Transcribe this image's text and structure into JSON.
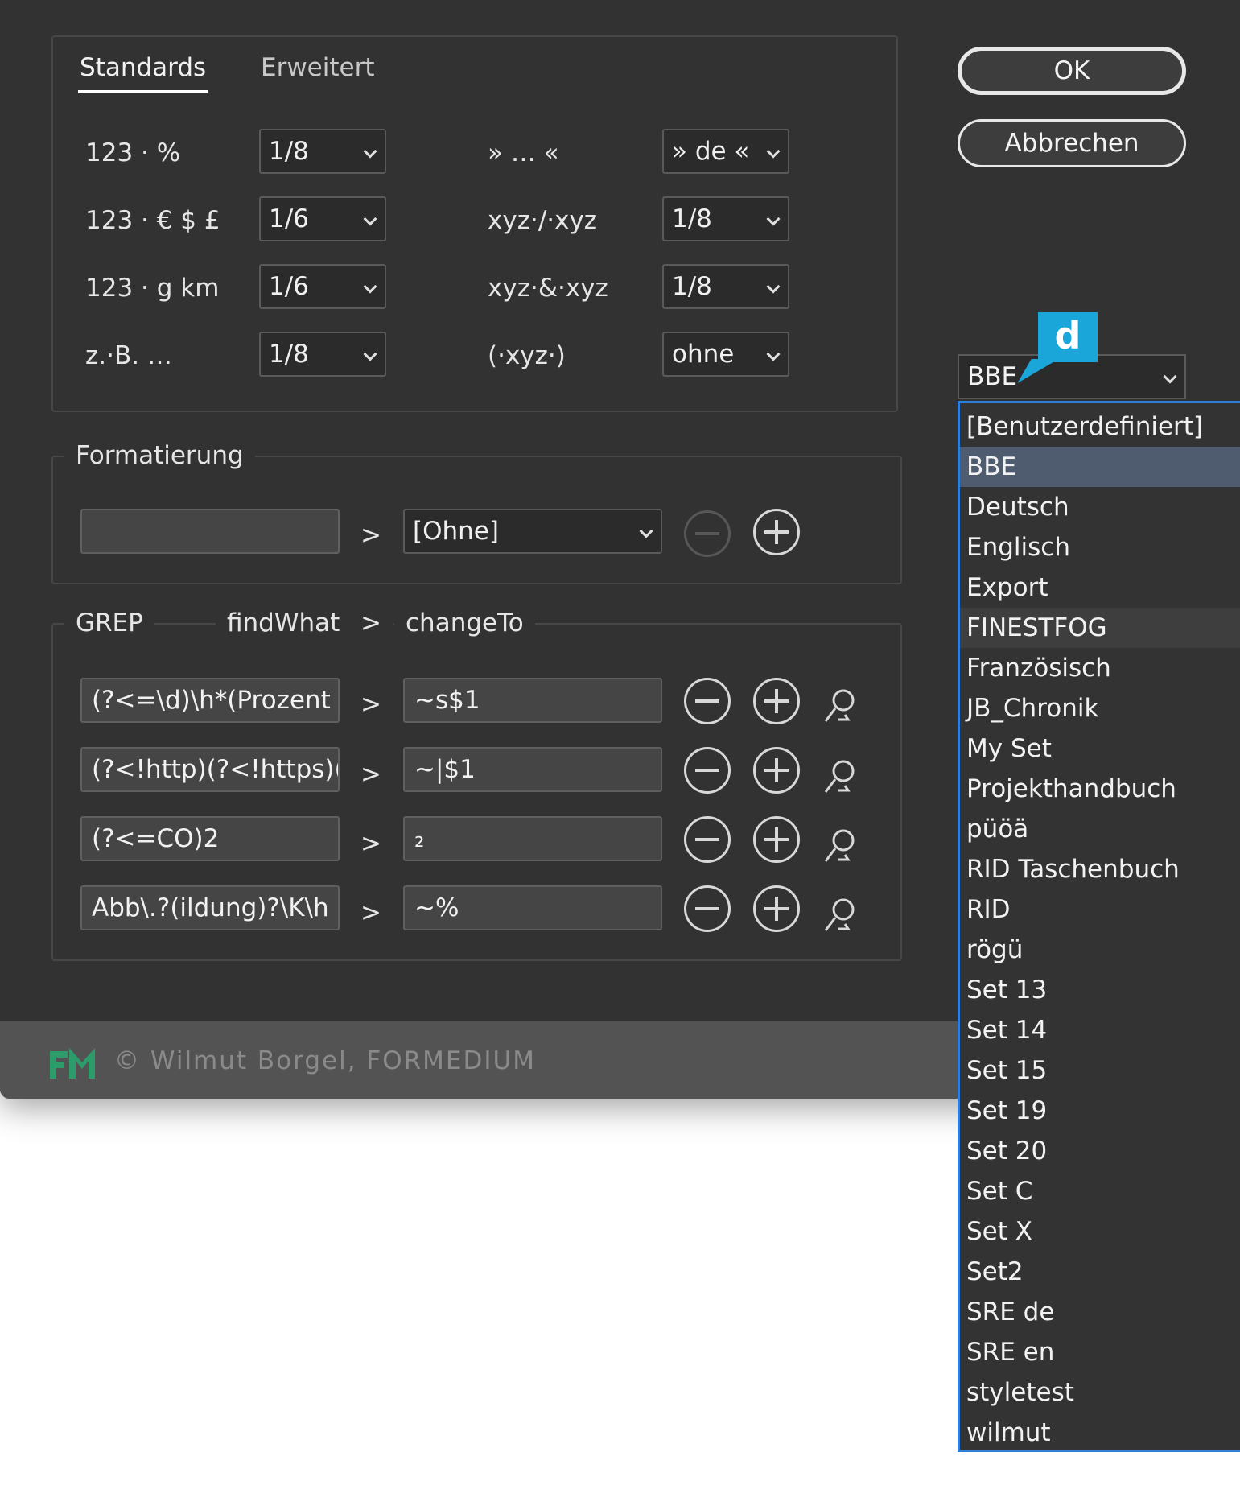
{
  "tabs": {
    "standards": "Standards",
    "extended": "Erweitert"
  },
  "standards_rows": [
    {
      "label": "123 · %",
      "value": "1/8"
    },
    {
      "label": "123 · € $ £",
      "value": "1/6"
    },
    {
      "label": "123 · g km",
      "value": "1/6"
    },
    {
      "label": "z.·B. …",
      "value": "1/8"
    }
  ],
  "standards_rows_right": [
    {
      "label": "» … «",
      "value": "» de «"
    },
    {
      "label": "xyz·/·xyz",
      "value": "1/8"
    },
    {
      "label": "xyz·&·xyz",
      "value": "1/8"
    },
    {
      "label": "(·xyz·)",
      "value": "ohne"
    }
  ],
  "formatting": {
    "legend": "Formatierung",
    "input_value": "",
    "arrow": ">",
    "style_value": "[Ohne]"
  },
  "grep": {
    "legend_grep": "GREP",
    "legend_find": "findWhat",
    "legend_arrow": ">",
    "legend_change": "changeTo",
    "rows": [
      {
        "find": "(?<=\\d)\\h*(Prozent",
        "arrow": ">",
        "change": "~s$1"
      },
      {
        "find": "(?<!http)(?<!https)(:",
        "arrow": ">",
        "change": "~|$1"
      },
      {
        "find": "(?<=CO)2",
        "arrow": ">",
        "change": "₂"
      },
      {
        "find": "Abb\\.?(ildung)?\\K\\h",
        "arrow": ">",
        "change": "~%"
      }
    ]
  },
  "buttons": {
    "ok": "OK",
    "cancel": "Abbrechen"
  },
  "set_select": {
    "value": "BBE",
    "badge": "d"
  },
  "dropdown_items": [
    "[Benutzerdefiniert]",
    "BBE",
    "Deutsch",
    "Englisch",
    "Export",
    "FINESTFOG",
    "Französisch",
    "JB_Chronik",
    "My Set",
    "Projekthandbuch",
    "püöä",
    "RID Taschenbuch",
    "RID",
    "rögü",
    "Set 13",
    "Set 14",
    "Set 15",
    "Set 19",
    "Set 20",
    "Set C",
    "Set X",
    "Set2",
    "SRE de",
    "SRE en",
    "styletest",
    "wilmut"
  ],
  "dropdown_selected": "BBE",
  "dropdown_hover": "FINESTFOG",
  "footer": {
    "copyright": "© Wilmut Borgel, FORMEDIUM"
  },
  "colors": {
    "accent": "#1aa6d9",
    "logo_green": "#2e9c6a",
    "dropdown_border": "#2f7ed8"
  },
  "icons": {
    "minus": "minus-circle-icon",
    "plus": "plus-circle-icon",
    "search": "search-person-icon",
    "chevron": "chevron-down-icon"
  }
}
